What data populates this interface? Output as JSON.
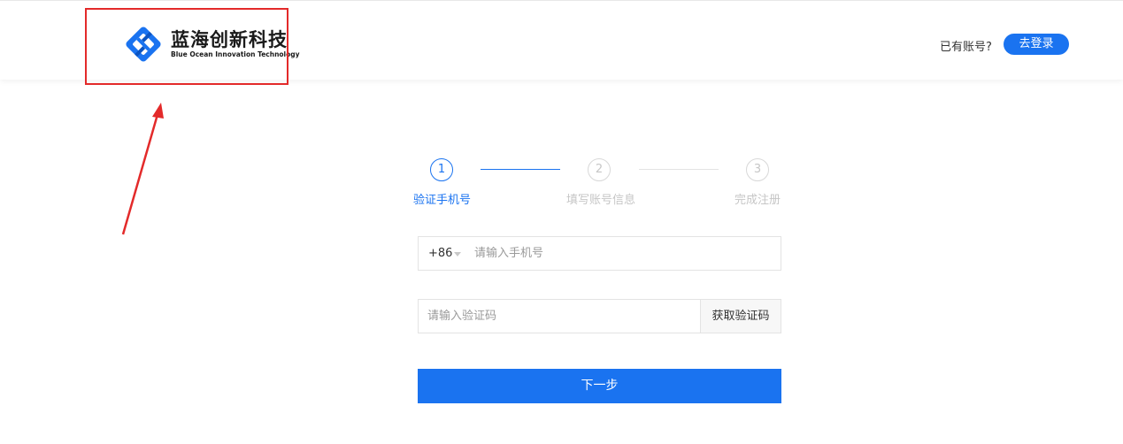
{
  "header": {
    "logo": {
      "name_cn": "蓝海创新科技",
      "name_en": "Blue Ocean Innovation Technology"
    },
    "has_account_text": "已有账号?",
    "login_button": "去登录"
  },
  "steps": [
    {
      "number": "1",
      "label": "验证手机号",
      "active": true
    },
    {
      "number": "2",
      "label": "填写账号信息",
      "active": false
    },
    {
      "number": "3",
      "label": "完成注册",
      "active": false
    }
  ],
  "form": {
    "phone": {
      "country_code": "+86",
      "placeholder": "请输入手机号",
      "value": ""
    },
    "verify_code": {
      "placeholder": "请输入验证码",
      "value": "",
      "get_code_button": "获取验证码"
    },
    "next_button": "下一步"
  },
  "colors": {
    "primary": "#1a73f0",
    "annotation_red": "#e32a2a",
    "inactive": "#c6c6c6"
  }
}
